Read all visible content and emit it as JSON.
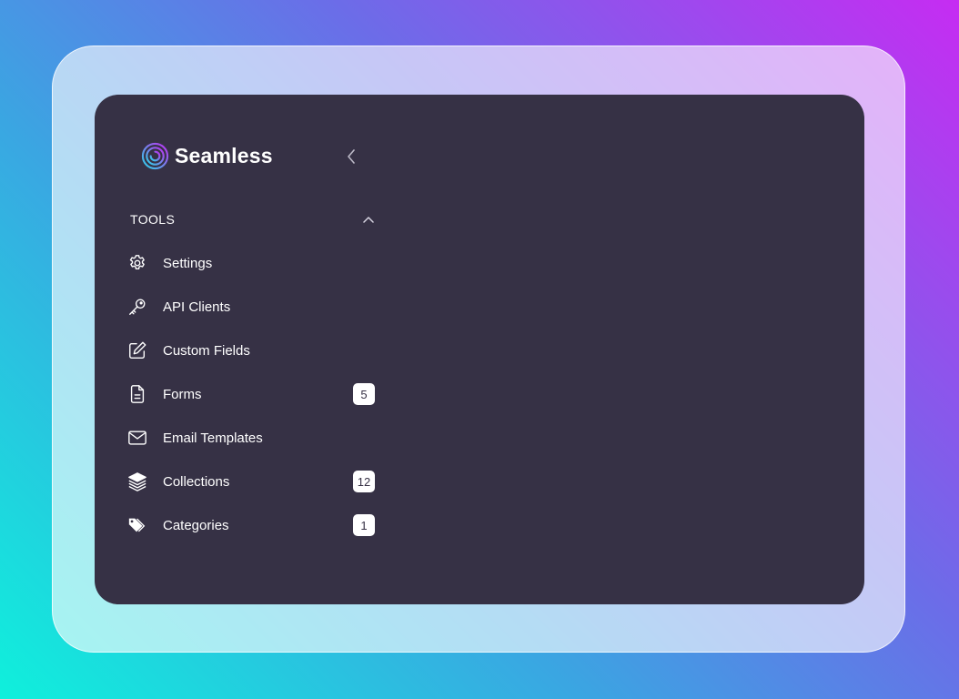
{
  "brand": {
    "name": "Seamless"
  },
  "section": {
    "title": "TOOLS",
    "expanded": true
  },
  "nav": {
    "items": [
      {
        "label": "Settings",
        "icon": "gear-icon",
        "badge": null
      },
      {
        "label": "API Clients",
        "icon": "key-icon",
        "badge": null
      },
      {
        "label": "Custom Fields",
        "icon": "edit-icon",
        "badge": null
      },
      {
        "label": "Forms",
        "icon": "document-icon",
        "badge": "5"
      },
      {
        "label": "Email Templates",
        "icon": "mail-icon",
        "badge": null
      },
      {
        "label": "Collections",
        "icon": "layers-icon",
        "badge": "12"
      },
      {
        "label": "Categories",
        "icon": "tags-icon",
        "badge": "1"
      }
    ]
  },
  "colors": {
    "panel": "#363145",
    "text": "#ffffff",
    "badge_bg": "#ffffff",
    "badge_text": "#363145",
    "logo_gradient_start": "#2ad6e8",
    "logo_gradient_end": "#c02cf0"
  }
}
